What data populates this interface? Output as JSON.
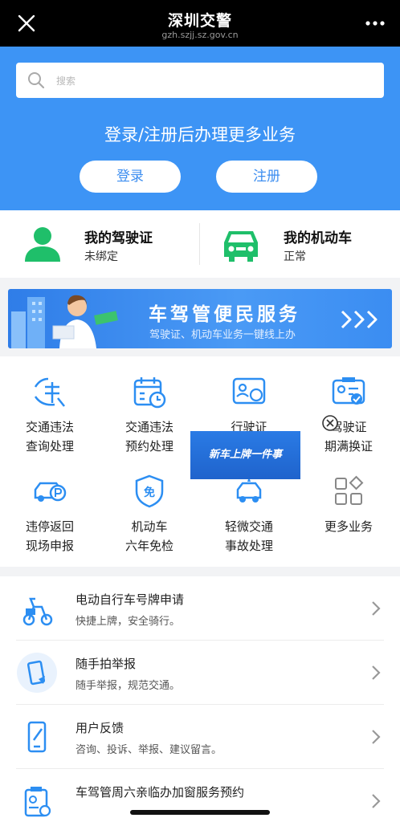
{
  "topbar": {
    "title": "深圳交警",
    "url": "gzh.szjj.sz.gov.cn"
  },
  "hero": {
    "search_placeholder": "搜索",
    "slogan": "登录/注册后办理更多业务",
    "login_label": "登录",
    "register_label": "注册",
    "colors": {
      "hero_bg": "#3d94f5"
    }
  },
  "status": {
    "license": {
      "label": "我的驾驶证",
      "value": "未绑定",
      "icon": "person-icon"
    },
    "vehicle": {
      "label": "我的机动车",
      "value": "正常",
      "icon": "car-icon"
    },
    "colors": {
      "green": "#1fbf6a"
    }
  },
  "banner": {
    "title": "车驾管便民服务",
    "subtitle": "驾驶证、机动车业务一键线上办"
  },
  "grid": {
    "items": [
      {
        "l1": "交通违法",
        "l2": "查询处理",
        "icon": "violation-icon"
      },
      {
        "l1": "交通违法",
        "l2": "预约处理",
        "icon": "calendar-icon"
      },
      {
        "l1": "行驶证",
        "l2": "",
        "icon": "vehicle-license-icon"
      },
      {
        "l1": "驾驶证",
        "l2": "期满换证",
        "icon": "license-renew-icon"
      },
      {
        "l1": "违停返回",
        "l2": "现场申报",
        "icon": "parking-car-icon"
      },
      {
        "l1": "机动车",
        "l2": "六年免检",
        "icon": "exempt-icon"
      },
      {
        "l1": "轻微交通",
        "l2": "事故处理",
        "icon": "accident-icon"
      },
      {
        "l1": "更多业务",
        "l2": "",
        "icon": "more-grid-icon"
      }
    ],
    "popup_label": "新车上牌一件事"
  },
  "list": {
    "items": [
      {
        "title": "电动自行车号牌申请",
        "subtitle": "快捷上牌，安全骑行。",
        "icon": "ebike-icon"
      },
      {
        "title": "随手拍举报",
        "subtitle": "随手举报，规范交通。",
        "icon": "phone-snap-icon"
      },
      {
        "title": "用户反馈",
        "subtitle": "咨询、投诉、举报、建议留言。",
        "icon": "feedback-icon"
      },
      {
        "title": "车驾管周六亲临办加窗服务预约",
        "subtitle": "",
        "icon": "appointment-icon"
      }
    ]
  },
  "colors": {
    "accent": "#3d94f5",
    "icon_blue": "#2c8ef2"
  }
}
